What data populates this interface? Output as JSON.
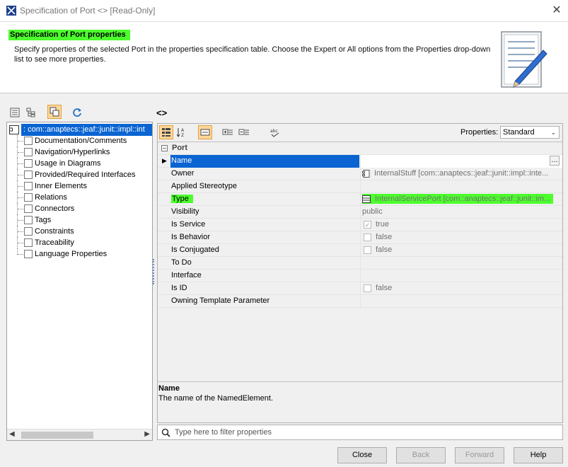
{
  "window": {
    "title": "Specification of Port <> [Read-Only]",
    "close_glyph": "✕"
  },
  "header": {
    "title": "Specification of Port properties",
    "description": "Specify properties of the selected Port in the properties specification table. Choose the Expert or All options from the Properties drop-down list to see more properties."
  },
  "tree": {
    "root_label": ": com::anaptecs::jeaf::junit::impl::int",
    "items": [
      {
        "label": "Documentation/Comments"
      },
      {
        "label": "Navigation/Hyperlinks"
      },
      {
        "label": "Usage in Diagrams"
      },
      {
        "label": "Provided/Required Interfaces"
      },
      {
        "label": "Inner Elements"
      },
      {
        "label": "Relations"
      },
      {
        "label": "Connectors"
      },
      {
        "label": "Tags"
      },
      {
        "label": "Constraints"
      },
      {
        "label": "Traceability"
      },
      {
        "label": "Language Properties"
      }
    ]
  },
  "element_title": "<>",
  "properties": {
    "label": "Properties:",
    "selected": "Standard",
    "group": "Port",
    "rows": [
      {
        "name": "Name",
        "value": "",
        "selected": true
      },
      {
        "name": "Owner",
        "value": "InternalStuff [com::anaptecs::jeaf::junit::impl::inte..."
      },
      {
        "name": "Applied Stereotype",
        "value": ""
      },
      {
        "name": "Type",
        "value": "InternalServicePort [com::anaptecs::jeaf::junit::im...",
        "highlight": true
      },
      {
        "name": "Visibility",
        "value": "public"
      },
      {
        "name": "Is Service",
        "value": "true",
        "checkbox": true,
        "checked": true
      },
      {
        "name": "Is Behavior",
        "value": "false",
        "checkbox": true
      },
      {
        "name": "Is Conjugated",
        "value": "false",
        "checkbox": true
      },
      {
        "name": "To Do",
        "value": ""
      },
      {
        "name": "Interface",
        "value": ""
      },
      {
        "name": "Is ID",
        "value": "false",
        "checkbox": true
      },
      {
        "name": "Owning Template Parameter",
        "value": ""
      }
    ],
    "ellipsis": "..."
  },
  "description_panel": {
    "title": "Name",
    "text": "The name of the NamedElement."
  },
  "filter": {
    "placeholder": "Type here to filter properties"
  },
  "buttons": {
    "close": "Close",
    "back": "Back",
    "forward": "Forward",
    "help": "Help"
  },
  "colors": {
    "highlight": "#4cff2c",
    "selection": "#0a64d2",
    "active_toolbar": "#ffd79a"
  }
}
